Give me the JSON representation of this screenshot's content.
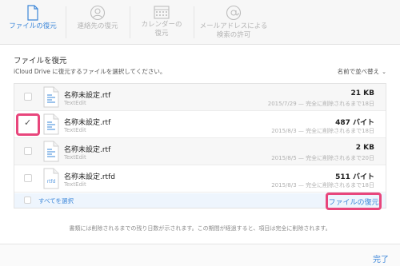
{
  "toolbar": {
    "tabs": [
      {
        "label": "ファイルの復元",
        "icon": "document-icon",
        "active": true
      },
      {
        "label": "連絡先の復元",
        "icon": "contact-icon",
        "active": false
      },
      {
        "label": "カレンダーの\n復元",
        "icon": "calendar-icon",
        "active": false
      },
      {
        "label": "メールアドレスによる\n検索の許可",
        "icon": "at-sign-icon",
        "active": false
      }
    ]
  },
  "section": {
    "title": "ファイルを復元",
    "description": "iCloud Drive に復元するファイルを選択してください。",
    "sort_label": "名前で並べ替え"
  },
  "files": [
    {
      "name": "名称未設定.rtf",
      "app": "TextEdit",
      "size": "21 KB",
      "date": "2015/7/29 — 完全に削除されるまで18日",
      "checked": false,
      "icon_type": "rtf"
    },
    {
      "name": "名称未設定.rtf",
      "app": "TextEdit",
      "size": "487 バイト",
      "date": "2015/8/3 — 完全に削除されるまで18日",
      "checked": true,
      "icon_type": "rtf"
    },
    {
      "name": "名称未設定.rtf",
      "app": "TextEdit",
      "size": "2 KB",
      "date": "2015/8/5 — 完全に削除されるまで20日",
      "checked": false,
      "icon_type": "rtf"
    },
    {
      "name": "名称未設定.rtfd",
      "app": "TextEdit",
      "size": "511 バイト",
      "date": "2015/8/3 — 完全に削除されるまで18日",
      "checked": false,
      "icon_type": "rtfd",
      "icon_label": "rtfd"
    }
  ],
  "footer": {
    "select_all_label": "すべてを選択",
    "restore_label": "ファイルの復元"
  },
  "note": "書類には削除されるまでの残り日数が示されます。この期間が経過すると、項目は完全に削除されます。",
  "bottom": {
    "done_label": "完了"
  },
  "colors": {
    "accent": "#3d87d9",
    "highlight": "#e8467c"
  }
}
